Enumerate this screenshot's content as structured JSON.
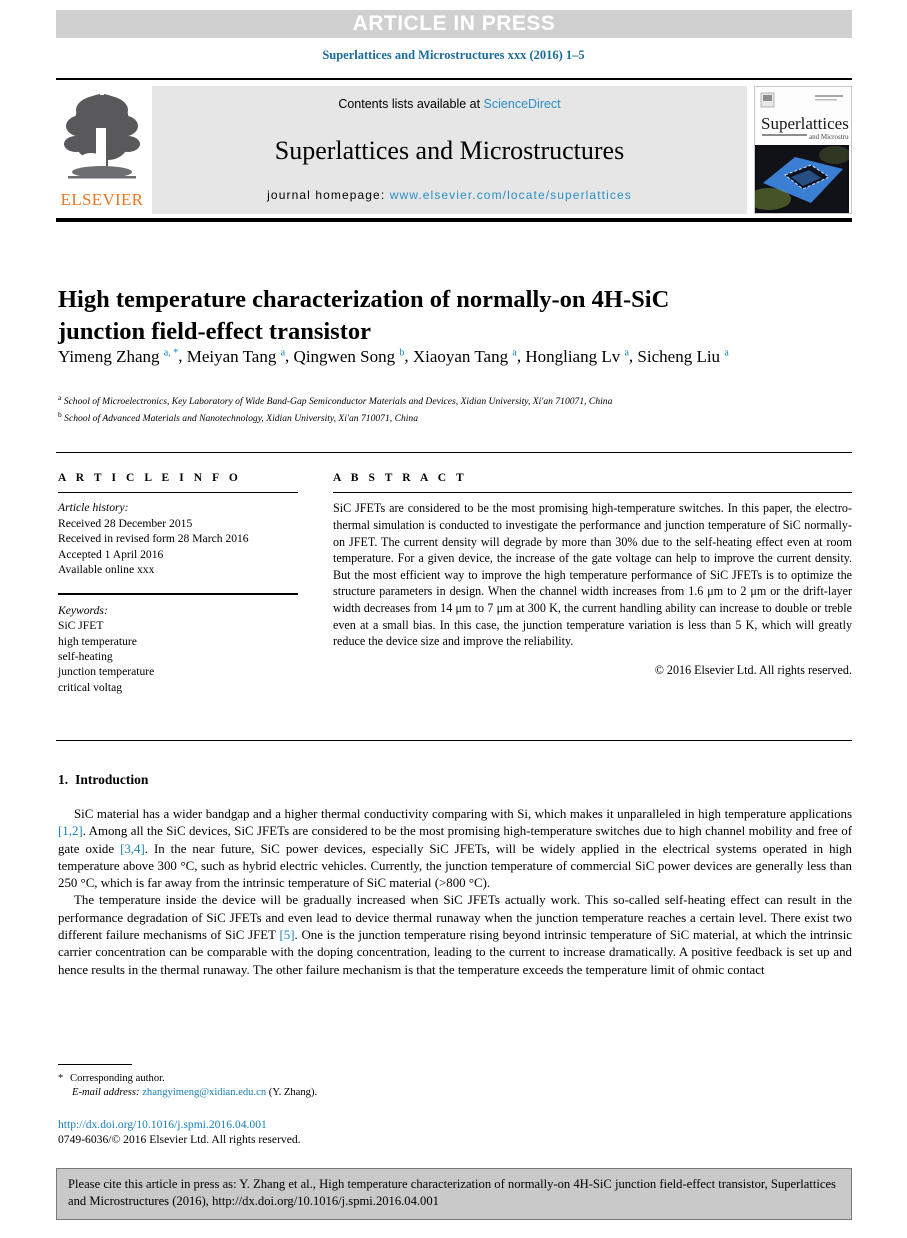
{
  "banner": {
    "text": "ARTICLE IN PRESS",
    "bg_color": "#d0d0d0",
    "text_color": "#ffffff"
  },
  "journal_ref": "Superlattices and Microstructures xxx (2016) 1–5",
  "masthead": {
    "publisher_name": "ELSEVIER",
    "publisher_color": "#e87722",
    "contents_prefix": "Contents lists available at ",
    "contents_link": "ScienceDirect",
    "journal_title": "Superlattices and Microstructures",
    "homepage_prefix": "journal homepage: ",
    "homepage_url": "www.elsevier.com/locate/superlattices",
    "link_color": "#2a8fc4",
    "cover_title_main": "Superlattices",
    "cover_title_sub": "and Microstructures"
  },
  "article": {
    "title": "High temperature characterization of normally-on 4H-SiC junction field-effect transistor",
    "authors": [
      {
        "name": "Yimeng Zhang",
        "marks": "a, *"
      },
      {
        "name": "Meiyan Tang",
        "marks": "a"
      },
      {
        "name": "Qingwen Song",
        "marks": "b"
      },
      {
        "name": "Xiaoyan Tang",
        "marks": "a"
      },
      {
        "name": "Hongliang Lv",
        "marks": "a"
      },
      {
        "name": "Sicheng Liu",
        "marks": "a"
      }
    ],
    "affiliations": [
      {
        "mark": "a",
        "text": "School of Microelectronics, Key Laboratory of Wide Band-Gap Semiconductor Materials and Devices, Xidian University, Xi'an 710071, China"
      },
      {
        "mark": "b",
        "text": "School of Advanced Materials and Nanotechnology, Xidian University, Xi'an 710071, China"
      }
    ]
  },
  "article_info": {
    "heading": "A R T I C L E  I N F O",
    "history_label": "Article history:",
    "history": [
      "Received 28 December 2015",
      "Received in revised form 28 March 2016",
      "Accepted 1 April 2016",
      "Available online xxx"
    ],
    "keywords_label": "Keywords:",
    "keywords": [
      "SiC JFET",
      "high temperature",
      "self-heating",
      "junction temperature",
      "critical voltag"
    ]
  },
  "abstract": {
    "heading": "A B S T R A C T",
    "text": "SiC JFETs are considered to be the most promising high-temperature switches. In this paper, the electro-thermal simulation is conducted to investigate the performance and junction temperature of SiC normally-on JFET. The current density will degrade by more than 30% due to the self-heating effect even at room temperature. For a given device, the increase of the gate voltage can help to improve the current density. But the most efficient way to improve the high temperature performance of SiC JFETs is to optimize the structure parameters in design. When the channel width increases from 1.6 μm to 2 μm or the drift-layer width decreases from 14 μm to 7 μm at 300 K, the current handling ability can increase to double or treble even at a small bias. In this case, the junction temperature variation is less than 5 K, which will greatly reduce the device size and improve the reliability.",
    "copyright": "© 2016 Elsevier Ltd. All rights reserved."
  },
  "section": {
    "number": "1.",
    "title": "Introduction"
  },
  "body": {
    "paragraph1_parts": [
      {
        "type": "text",
        "value": "SiC material has a wider bandgap and a higher thermal conductivity comparing with Si, which makes it unparalleled in high temperature applications "
      },
      {
        "type": "ref",
        "value": "[1,2]"
      },
      {
        "type": "text",
        "value": ". Among all the SiC devices, SiC JFETs are considered to be the most promising high-temperature switches due to high channel mobility and free of gate oxide "
      },
      {
        "type": "ref",
        "value": "[3,4]"
      },
      {
        "type": "text",
        "value": ". In the near future, SiC power devices, especially SiC JFETs, will be widely applied in the electrical systems operated in high temperature above 300 °C, such as hybrid electric vehicles. Currently, the junction temperature of commercial SiC power devices are generally less than 250 °C, which is far away from the intrinsic temperature of SiC material (>800 °C)."
      }
    ],
    "paragraph2_parts": [
      {
        "type": "text",
        "value": "The temperature inside the device will be gradually increased when SiC JFETs actually work. This so-called self-heating effect can result in the performance degradation of SiC JFETs and even lead to device thermal runaway when the junction temperature reaches a certain level. There exist two different failure mechanisms of SiC JFET "
      },
      {
        "type": "ref",
        "value": "[5]"
      },
      {
        "type": "text",
        "value": ". One is the junction temperature rising beyond intrinsic temperature of SiC material, at which the intrinsic carrier concentration can be comparable with the doping concentration, leading to the current to increase dramatically. A positive feedback is set up and hence results in the thermal runaway. The other failure mechanism is that the temperature exceeds the temperature limit of ohmic contact"
      }
    ]
  },
  "footnote": {
    "star": "*",
    "corresponding": "Corresponding author.",
    "email_label": "E-mail address:",
    "email": "zhangyimeng@xidian.edu.cn",
    "email_suffix": "(Y. Zhang)."
  },
  "footer": {
    "doi": "http://dx.doi.org/10.1016/j.spmi.2016.04.001",
    "issn": "0749-6036/© 2016 Elsevier Ltd. All rights reserved."
  },
  "citation_box": {
    "text": "Please cite this article in press as: Y. Zhang et al., High temperature characterization of normally-on 4H-SiC junction field-effect transistor, Superlattices and Microstructures (2016), http://dx.doi.org/10.1016/j.spmi.2016.04.001",
    "bg_color": "#c9c9c9"
  }
}
